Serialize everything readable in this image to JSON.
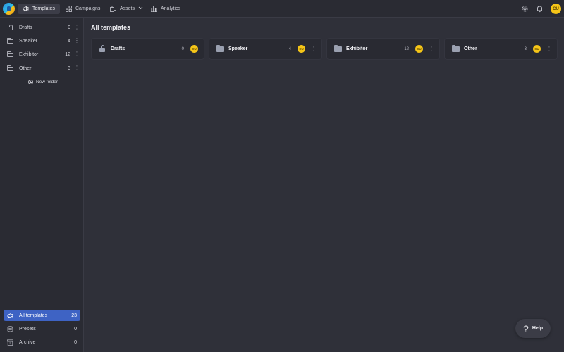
{
  "topbar": {
    "tabs": [
      {
        "label": "Templates",
        "icon": "megaphone-icon",
        "active": true
      },
      {
        "label": "Campaigns",
        "icon": "grid-icon",
        "active": false
      },
      {
        "label": "Assets",
        "icon": "assets-icon",
        "active": false
      },
      {
        "label": "Analytics",
        "icon": "bar-chart-icon",
        "active": false
      }
    ],
    "avatar_initials": "CU"
  },
  "sidebar": {
    "folders": [
      {
        "label": "Drafts",
        "count": "0",
        "icon": "lock-icon"
      },
      {
        "label": "Speaker",
        "count": "4",
        "icon": "folder-icon"
      },
      {
        "label": "Exhibitor",
        "count": "12",
        "icon": "folder-icon"
      },
      {
        "label": "Other",
        "count": "3",
        "icon": "folder-icon"
      }
    ],
    "new_folder_label": "New folder",
    "bottom": [
      {
        "label": "All templates",
        "count": "23",
        "selected": true,
        "icon": "megaphone-icon"
      },
      {
        "label": "Presets",
        "count": "0",
        "selected": false,
        "icon": "stack-icon"
      },
      {
        "label": "Archive",
        "count": "0",
        "selected": false,
        "icon": "archive-icon"
      }
    ]
  },
  "main": {
    "title": "All templates",
    "cards": [
      {
        "name": "Drafts",
        "count": "0",
        "avatar": "CU",
        "icon": "lock-icon"
      },
      {
        "name": "Speaker",
        "count": "4",
        "avatar": "CU",
        "icon": "folder-icon"
      },
      {
        "name": "Exhibitor",
        "count": "12",
        "avatar": "CU",
        "icon": "folder-icon"
      },
      {
        "name": "Other",
        "count": "3",
        "avatar": "CU",
        "icon": "folder-icon"
      }
    ]
  },
  "help": {
    "label": "Help"
  },
  "colors": {
    "accent": "#3e63c4",
    "avatar": "#f5c518",
    "background": "#2f3039",
    "sidebar": "#2a2b33"
  }
}
